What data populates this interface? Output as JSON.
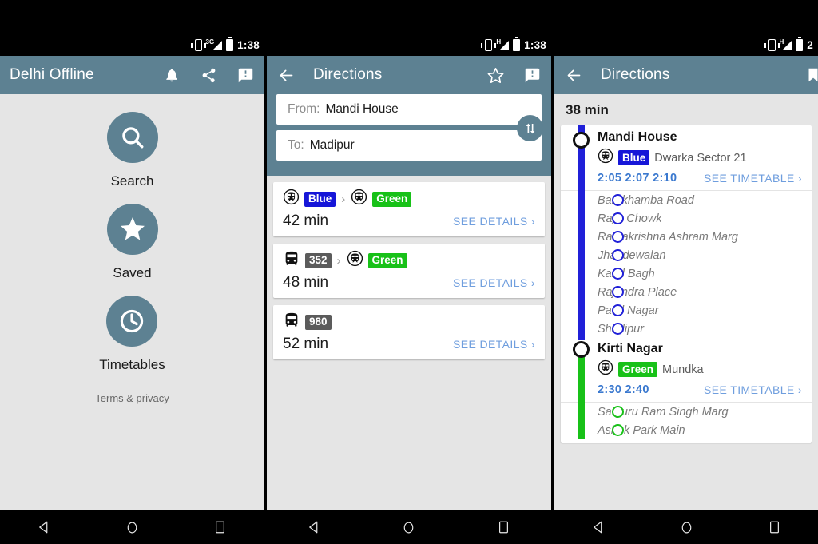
{
  "panels": [
    {
      "id": "home",
      "statusbar": {
        "network": "3G",
        "time": "1:38"
      },
      "toolbar": {
        "title": "Delhi Offline",
        "icons": [
          "notifications-icon",
          "share-icon",
          "feedback-icon"
        ]
      },
      "tiles": [
        {
          "label": "Search",
          "icon": "search-icon"
        },
        {
          "label": "Saved",
          "icon": "star-icon"
        },
        {
          "label": "Timetables",
          "icon": "clock-icon"
        }
      ],
      "footer_link": "Terms & privacy"
    },
    {
      "id": "directions-search",
      "statusbar": {
        "network": "H",
        "time": "1:38"
      },
      "toolbar": {
        "title": "Directions",
        "back": "back-arrow-icon",
        "icons": [
          "star-outline-icon",
          "feedback-icon"
        ]
      },
      "fields": {
        "from_label": "From:",
        "from_value": "Mandi House",
        "to_label": "To:",
        "to_value": "Madipur",
        "swap": "swap-vertical-icon"
      },
      "results": [
        {
          "modes": [
            {
              "icon": "metro-icon",
              "badge": "Blue",
              "badge_color": "blue"
            },
            {
              "icon": "metro-icon",
              "badge": "Green",
              "badge_color": "green"
            }
          ],
          "duration": "42 min",
          "action": "SEE DETAILS"
        },
        {
          "modes": [
            {
              "icon": "bus-icon",
              "badge": "352",
              "badge_color": "gray"
            },
            {
              "icon": "metro-icon",
              "badge": "Green",
              "badge_color": "green"
            }
          ],
          "duration": "48 min",
          "action": "SEE DETAILS"
        },
        {
          "modes": [
            {
              "icon": "bus-icon",
              "badge": "980",
              "badge_color": "gray"
            }
          ],
          "duration": "52 min",
          "action": "SEE DETAILS"
        }
      ]
    },
    {
      "id": "directions-detail",
      "statusbar": {
        "network": "H",
        "time": "2"
      },
      "toolbar": {
        "title": "Directions",
        "back": "back-arrow-icon",
        "icons": [
          "flag-icon"
        ]
      },
      "trip_duration": "38 min",
      "legs": [
        {
          "rail_color": "blue",
          "station": "Mandi House",
          "line_icon": "metro-icon",
          "line_badge": "Blue",
          "badge_color": "blue",
          "headsign": "Dwarka Sector 21",
          "times": "2:05 2:07 2:10",
          "action": "SEE TIMETABLE",
          "stops": [
            "Barakhamba Road",
            "Rajiv Chowk",
            "Ramakrishna Ashram Marg",
            "Jhandewalan",
            "Karol Bagh",
            "Rajendra Place",
            "Patel Nagar",
            "Shadipur"
          ]
        },
        {
          "rail_color": "green",
          "station": "Kirti Nagar",
          "line_icon": "metro-icon",
          "line_badge": "Green",
          "badge_color": "green",
          "headsign": "Mundka",
          "times": "2:30 2:40",
          "action": "SEE TIMETABLE",
          "stops": [
            "Satguru Ram Singh Marg",
            "Ashok Park Main"
          ]
        }
      ]
    }
  ],
  "navbar": {
    "back": "triangle-back-icon",
    "home": "circle-home-icon",
    "recents": "square-recents-icon"
  },
  "colors": {
    "toolbar": "#5d8192",
    "background": "#e5e5e5",
    "blue_line": "#1616d8",
    "green_line": "#18c118",
    "gray_badge": "#5b5b5b",
    "link": "#6f9ede",
    "time_text": "#3b79cf"
  }
}
